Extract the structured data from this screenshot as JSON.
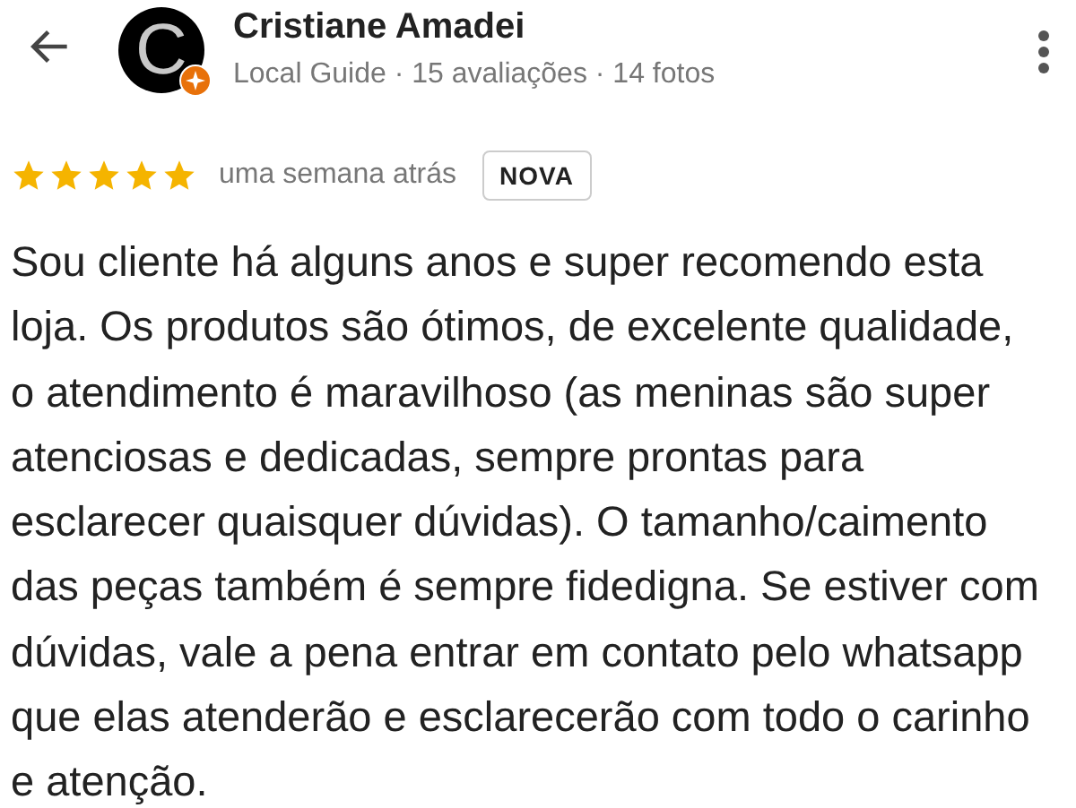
{
  "reviewer": {
    "avatar_letter": "C",
    "name": "Cristiane Amadei",
    "meta": "Local Guide · 15 avaliações · 14 fotos"
  },
  "review": {
    "stars": 5,
    "time": "uma semana atrás",
    "badge": "NOVA",
    "lines": [
      "Sou cliente há alguns anos e super recomendo esta",
      "loja. Os produtos são ótimos, de excelente qualidade,",
      "o atendimento é maravilhoso (as meninas são super",
      "atenciosas e dedicadas, sempre prontas para",
      "esclarecer quaisquer dúvidas). O tamanho/caimento",
      "das peças também é sempre fidedigna. Se estiver com",
      "dúvidas, vale a pena entrar em contato pelo whatsapp",
      "que elas atenderão e esclarecerão com todo o carinho",
      "e atenção."
    ]
  }
}
